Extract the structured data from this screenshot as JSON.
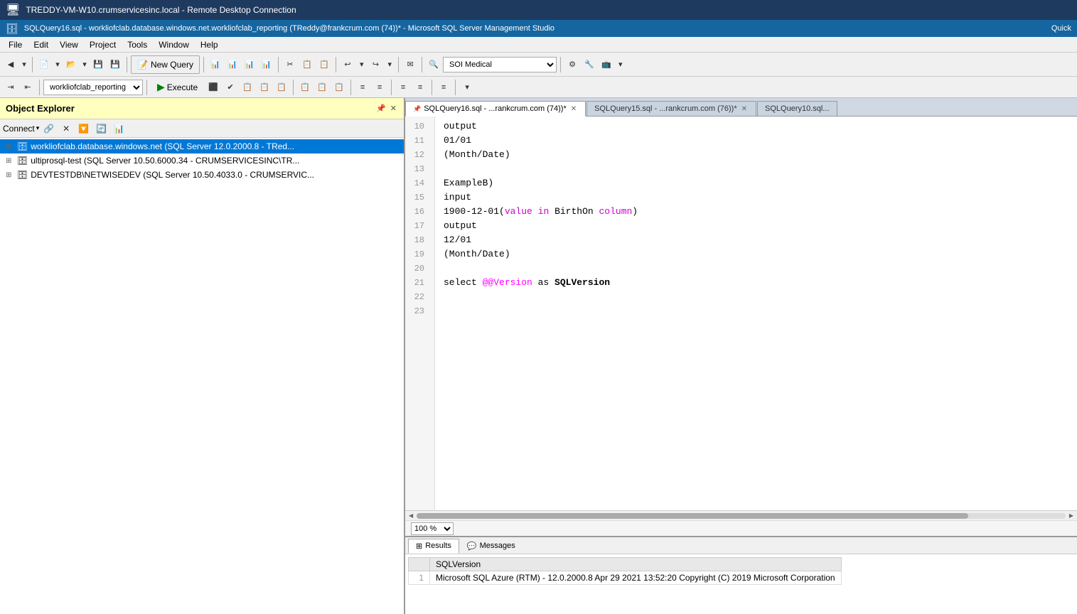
{
  "titlebar": {
    "text": "TREDDY-VM-W10.crumservicesinc.local - Remote Desktop Connection"
  },
  "app_title": "SQLQuery16.sql - workliofclab.database.windows.net.workliofclab_reporting (TReddy@frankcrum.com (74))* - Microsoft SQL Server Management Studio",
  "menu": {
    "items": [
      "File",
      "Edit",
      "View",
      "Project",
      "Tools",
      "Window",
      "Help"
    ]
  },
  "toolbar": {
    "new_query_label": "New Query",
    "execute_label": "Execute",
    "database_value": "workliofclab_reporting",
    "connection_value": "SOI Medical",
    "quick_label": "Quick"
  },
  "object_explorer": {
    "title": "Object Explorer",
    "servers": [
      "workliofclab.database.windows.net (SQL Server 12.0.2000.8 - TRed...",
      "ultiprosql-test (SQL Server 10.50.6000.34 - CRUMSERVICESINC\\TR...",
      "DEVTESTDB\\NETWISEDEV (SQL Server 10.50.4033.0 - CRUMSERVIC..."
    ]
  },
  "tabs": [
    {
      "id": "tab1",
      "label": "SQLQuery16.sql - ...rankcrum.com (74))*",
      "active": true,
      "pinned": true,
      "closeable": true
    },
    {
      "id": "tab2",
      "label": "SQLQuery15.sql - ...rankcrum.com (76))*",
      "active": false,
      "closeable": true
    },
    {
      "id": "tab3",
      "label": "SQLQuery10.sql...",
      "active": false,
      "closeable": false
    }
  ],
  "code": {
    "lines": [
      {
        "num": 10,
        "content": "output",
        "type": "plain"
      },
      {
        "num": 11,
        "content": "01/01",
        "type": "plain"
      },
      {
        "num": 12,
        "content": "(Month/Date)",
        "type": "plain"
      },
      {
        "num": 13,
        "content": "",
        "type": "plain"
      },
      {
        "num": 14,
        "content": "ExampleB)",
        "type": "plain"
      },
      {
        "num": 15,
        "content": "input",
        "type": "plain"
      },
      {
        "num": 16,
        "content": "1900-12-01(value in BirthOn column)",
        "type": "mixed"
      },
      {
        "num": 17,
        "content": "output",
        "type": "plain"
      },
      {
        "num": 18,
        "content": "12/01",
        "type": "plain"
      },
      {
        "num": 19,
        "content": "(Month/Date)",
        "type": "plain"
      },
      {
        "num": 20,
        "content": "",
        "type": "plain"
      },
      {
        "num": 21,
        "content": "select @@Version as SQLVersion",
        "type": "sql"
      },
      {
        "num": 22,
        "content": "",
        "type": "plain"
      },
      {
        "num": 23,
        "content": "",
        "type": "plain"
      }
    ]
  },
  "zoom": {
    "value": "100 %"
  },
  "results": {
    "tabs": [
      "Results",
      "Messages"
    ],
    "active_tab": "Results",
    "columns": [
      "SQLVersion"
    ],
    "rows": [
      {
        "rownum": "1",
        "sqlversion": "Microsoft SQL Azure (RTM) - 12.0.2000.8  Apr 29 2021 13:52:20  Copyright (C) 2019 Microsoft Corporation"
      }
    ]
  }
}
